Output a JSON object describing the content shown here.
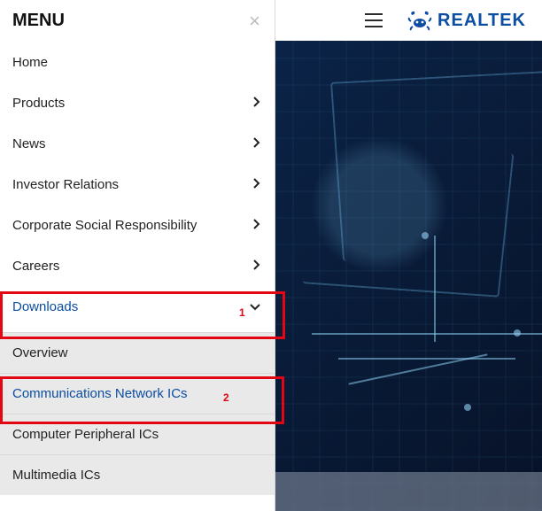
{
  "brand": {
    "name": "REALTEK"
  },
  "menu": {
    "title": "MENU",
    "items": [
      {
        "label": "Home",
        "hasChildren": false
      },
      {
        "label": "Products",
        "hasChildren": true
      },
      {
        "label": "News",
        "hasChildren": true
      },
      {
        "label": "Investor Relations",
        "hasChildren": true
      },
      {
        "label": "Corporate Social Responsibility",
        "hasChildren": true
      },
      {
        "label": "Careers",
        "hasChildren": true
      },
      {
        "label": "Downloads",
        "hasChildren": true,
        "expanded": true
      }
    ],
    "downloadsSubmenu": [
      {
        "label": "Overview"
      },
      {
        "label": "Communications Network ICs"
      },
      {
        "label": "Computer Peripheral ICs"
      },
      {
        "label": "Multimedia ICs"
      }
    ]
  },
  "annotations": {
    "callout1": "1",
    "callout2": "2"
  }
}
